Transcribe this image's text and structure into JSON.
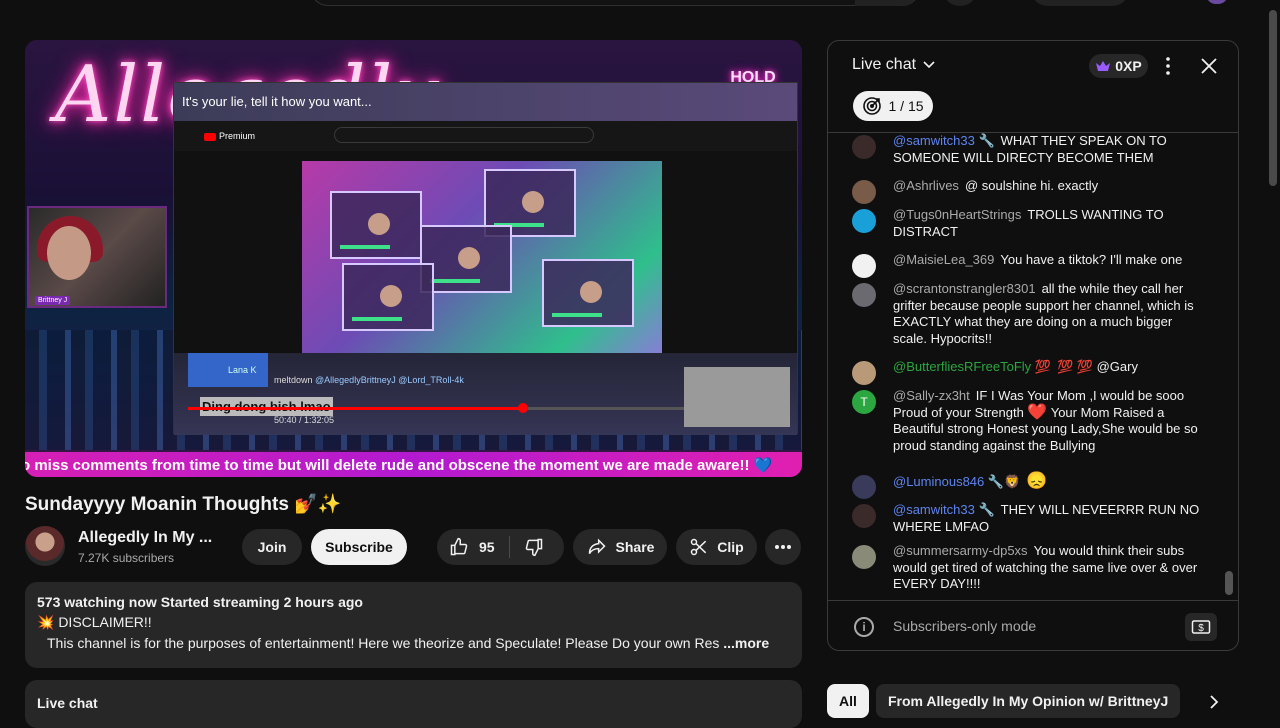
{
  "video": {
    "neon_text": "Allegedly",
    "hold_sign": "HOLD PLEASE",
    "webcam_tag": "Brittney J",
    "inner_caption": "It's your lie, tell it how you want...",
    "inner_logo": "Premium",
    "inner_lana": "Lana K",
    "inner_meta_prefix": "meltdown ",
    "inner_meta_handles": "@AllegedlyBrittneyJ @Lord_TRoll-4k",
    "inner_ding": "Ding dong bish lmao",
    "inner_time": "50:40 / 1:32:05",
    "inner_progress": 0.55,
    "ticker": "o miss comments from time to time but will delete rude and obscene the moment we are made aware!! 💙"
  },
  "title": "Sundayyyy Moanin Thoughts 💅✨",
  "channel": {
    "name": "Allegedly In My ...",
    "subscribers": "7.27K subscribers",
    "join_label": "Join",
    "subscribe_label": "Subscribe"
  },
  "actions": {
    "likes": "95",
    "share_label": "Share",
    "clip_label": "Clip"
  },
  "description": {
    "stats": "573 watching now  Started streaming 2 hours ago",
    "line2": "💥 DISCLAIMER!!",
    "line3": "This channel is for the purposes of entertainment!  Here we theorize and Speculate!  Please Do your own Res",
    "more_label": "...more"
  },
  "bottom_live_chat": "Live chat",
  "chat": {
    "title": "Live chat",
    "xp": "0XP",
    "goal": "1 / 15",
    "messages": [
      {
        "author": "@samwitch33 🔧",
        "text": "WHAT THEY SPEAK ON TO SOMEONE WILL DIRECTY BECOME THEM",
        "author_color": "blue",
        "avatar": "#3a2a2a"
      },
      {
        "author": "@Ashrlives",
        "text": "@ soulshine hi. exactly",
        "author_color": "gray",
        "avatar": "#7a5a48"
      },
      {
        "author": "@Tugs0nHeartStrings",
        "text": "TROLLS WANTING TO DISTRACT",
        "author_color": "gray",
        "avatar": "#1aa0d8"
      },
      {
        "author": "@MaisieLea_369",
        "text": "You have a tiktok? I'll make one",
        "author_color": "gray",
        "avatar": "#f1f1f1"
      },
      {
        "author": "@scrantonstrangler8301",
        "text": "all the while they call her grifter because people support her channel, which is EXACTLY what they are doing on a much bigger scale. Hypocrits!!",
        "author_color": "gray",
        "avatar": "#6a6a70"
      },
      {
        "author": "@ButterfliesRFreeToFly 💯",
        "text": "💯 💯 @Gary",
        "author_color": "green",
        "avatar": "#b89a78"
      },
      {
        "author": "@Sally-zx3ht",
        "text_a": "IF I Was Your Mom ,I would be sooo Proud of your Strength ",
        "heart": "❤️",
        "text_b": " Your Mom Raised a Beautiful strong Honest young Lady,She would be so proud standing against the Bullying",
        "author_color": "gray",
        "avatar": "#2ba640",
        "avatar_letter": "T"
      },
      {
        "author": "@Luminous846 🔧🦁",
        "text": "😞",
        "author_color": "blue",
        "avatar": "#3a3a5a"
      },
      {
        "author": "@samwitch33 🔧",
        "text": "THEY WILL NEVEERRR RUN NO WHERE LMFAO",
        "author_color": "blue",
        "avatar": "#3a2a2a"
      },
      {
        "author": "@summersarmy-dp5xs",
        "text": "You would think their subs would get tired of watching the same live over & over EVERY DAY!!!!",
        "author_color": "gray",
        "avatar": "#8a8a78"
      }
    ],
    "footer_text": "Subscribers-only mode",
    "footer_info_icon": "i"
  },
  "chips": {
    "all": "All",
    "from": "From Allegedly In My Opinion w/ BrittneyJ"
  }
}
